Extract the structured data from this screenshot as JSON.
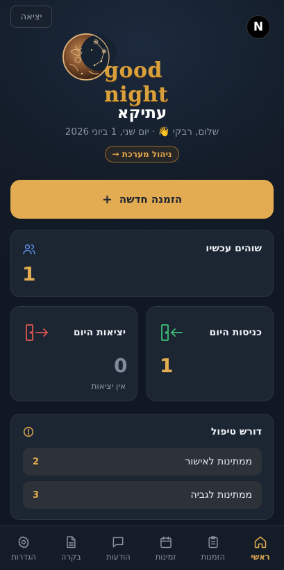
{
  "header": {
    "logout_label": "יציאה",
    "brand_badge": "N",
    "logo_text": "good night"
  },
  "page": {
    "title": "עתיקא",
    "greeting": "שלום, רבקי 👋 · יום שני, 1 ביוני 2026",
    "admin_label": "ניהול מערכת →"
  },
  "actions": {
    "new_order_label": "הזמנה חדשה",
    "new_order_icon": "+"
  },
  "stats": {
    "current": {
      "label": "שוהים עכשיו",
      "value": "1",
      "icon": "users-icon"
    },
    "checkins": {
      "label": "כניסות היום",
      "value": "1",
      "icon": "login-icon"
    },
    "checkouts": {
      "label": "יציאות היום",
      "value": "0",
      "subtext": "אין יציאות",
      "icon": "logout-icon"
    }
  },
  "attention": {
    "title": "דורש טיפול",
    "items": [
      {
        "label": "ממתינות לאישור",
        "count": "2"
      },
      {
        "label": "ממתינות לגביה",
        "count": "3"
      }
    ]
  },
  "nav": {
    "items": [
      {
        "label": "ראשי",
        "icon": "home-icon",
        "active": true
      },
      {
        "label": "הזמנות",
        "icon": "clipboard-icon"
      },
      {
        "label": "זמינות",
        "icon": "calendar-icon"
      },
      {
        "label": "הודעות",
        "icon": "message-icon"
      },
      {
        "label": "בקרה",
        "icon": "document-icon"
      },
      {
        "label": "הגדרות",
        "icon": "gear-icon"
      }
    ]
  },
  "colors": {
    "accent": "#e4ac52",
    "green": "#3ec17a",
    "red": "#e0564f",
    "blue": "#5a8fe6",
    "muted_value": "#7f8b9a"
  }
}
